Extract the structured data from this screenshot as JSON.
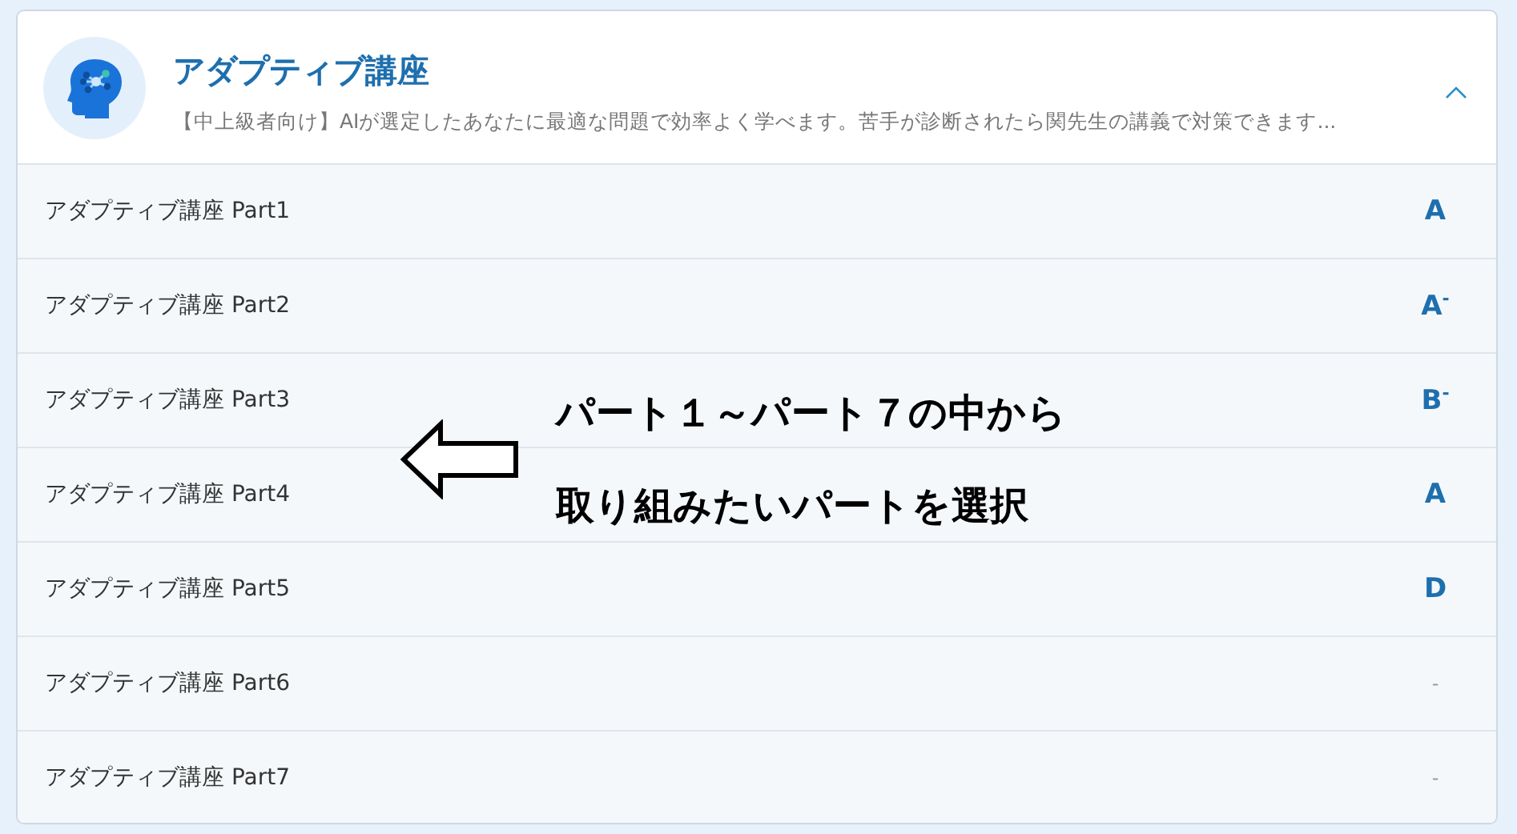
{
  "course": {
    "title": "アダプティブ講座",
    "description": "【中上級者向け】AIが選定したあなたに最適な問題で効率よく学べます。苦手が診断されたら関先生の講義で対策できます...",
    "expanded": true
  },
  "parts": [
    {
      "name": "アダプティブ講座 Part1",
      "grade": "A"
    },
    {
      "name": "アダプティブ講座 Part2",
      "grade": "A$^{-}$"
    },
    {
      "name": "アダプティブ講座 Part3",
      "grade": "B$^{-}$"
    },
    {
      "name": "アダプティブ講座 Part4",
      "grade": "A"
    },
    {
      "name": "アダプティブ講座 Part5",
      "grade": "D"
    },
    {
      "name": "アダプティブ講座 Part6",
      "grade": "-"
    },
    {
      "name": "アダプティブ講座 Part7",
      "grade": "-"
    }
  ],
  "annotation": {
    "lines": [
      "パート１～パート７の中から",
      "取り組みたいパートを選択"
    ]
  }
}
